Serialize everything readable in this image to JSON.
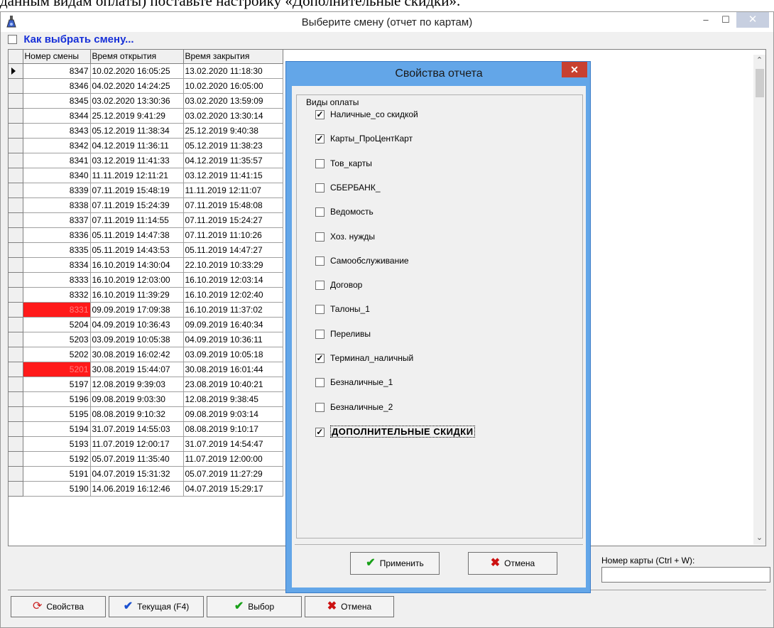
{
  "document": {
    "text_fragment": "данным видам оплаты) поставьте настройку «Дополнительные скидки»."
  },
  "window": {
    "title": "Выберите смену (отчет по картам)",
    "controls": {
      "minimize": "–",
      "maximize": "☐",
      "close": "✕"
    }
  },
  "help": {
    "checked": false,
    "link_text": "Как выбрать смену..."
  },
  "grid": {
    "columns": [
      "Номер смены",
      "Время открытия",
      "Время закрытия"
    ],
    "rows": [
      {
        "num": "8347",
        "open": "10.02.2020 16:05:25",
        "close": "13.02.2020 11:18:30",
        "current": true,
        "highlight": false
      },
      {
        "num": "8346",
        "open": "04.02.2020 14:24:25",
        "close": "10.02.2020 16:05:00",
        "current": false,
        "highlight": false
      },
      {
        "num": "8345",
        "open": "03.02.2020 13:30:36",
        "close": "03.02.2020 13:59:09",
        "current": false,
        "highlight": false
      },
      {
        "num": "8344",
        "open": "25.12.2019 9:41:29",
        "close": "03.02.2020 13:30:14",
        "current": false,
        "highlight": false
      },
      {
        "num": "8343",
        "open": "05.12.2019 11:38:34",
        "close": "25.12.2019 9:40:38",
        "current": false,
        "highlight": false
      },
      {
        "num": "8342",
        "open": "04.12.2019 11:36:11",
        "close": "05.12.2019 11:38:23",
        "current": false,
        "highlight": false
      },
      {
        "num": "8341",
        "open": "03.12.2019 11:41:33",
        "close": "04.12.2019 11:35:57",
        "current": false,
        "highlight": false
      },
      {
        "num": "8340",
        "open": "11.11.2019 12:11:21",
        "close": "03.12.2019 11:41:15",
        "current": false,
        "highlight": false
      },
      {
        "num": "8339",
        "open": "07.11.2019 15:48:19",
        "close": "11.11.2019 12:11:07",
        "current": false,
        "highlight": false
      },
      {
        "num": "8338",
        "open": "07.11.2019 15:24:39",
        "close": "07.11.2019 15:48:08",
        "current": false,
        "highlight": false
      },
      {
        "num": "8337",
        "open": "07.11.2019 11:14:55",
        "close": "07.11.2019 15:24:27",
        "current": false,
        "highlight": false
      },
      {
        "num": "8336",
        "open": "05.11.2019 14:47:38",
        "close": "07.11.2019 11:10:26",
        "current": false,
        "highlight": false
      },
      {
        "num": "8335",
        "open": "05.11.2019 14:43:53",
        "close": "05.11.2019 14:47:27",
        "current": false,
        "highlight": false
      },
      {
        "num": "8334",
        "open": "16.10.2019 14:30:04",
        "close": "22.10.2019 10:33:29",
        "current": false,
        "highlight": false
      },
      {
        "num": "8333",
        "open": "16.10.2019 12:03:00",
        "close": "16.10.2019 12:03:14",
        "current": false,
        "highlight": false
      },
      {
        "num": "8332",
        "open": "16.10.2019 11:39:29",
        "close": "16.10.2019 12:02:40",
        "current": false,
        "highlight": false
      },
      {
        "num": "8331",
        "open": "09.09.2019 17:09:38",
        "close": "16.10.2019 11:37:02",
        "current": false,
        "highlight": true
      },
      {
        "num": "5204",
        "open": "04.09.2019 10:36:43",
        "close": "09.09.2019 16:40:34",
        "current": false,
        "highlight": false
      },
      {
        "num": "5203",
        "open": "03.09.2019 10:05:38",
        "close": "04.09.2019 10:36:11",
        "current": false,
        "highlight": false
      },
      {
        "num": "5202",
        "open": "30.08.2019 16:02:42",
        "close": "03.09.2019 10:05:18",
        "current": false,
        "highlight": false
      },
      {
        "num": "5201",
        "open": "30.08.2019 15:44:07",
        "close": "30.08.2019 16:01:44",
        "current": false,
        "highlight": true
      },
      {
        "num": "5197",
        "open": "12.08.2019 9:39:03",
        "close": "23.08.2019 10:40:21",
        "current": false,
        "highlight": false
      },
      {
        "num": "5196",
        "open": "09.08.2019 9:03:30",
        "close": "12.08.2019 9:38:45",
        "current": false,
        "highlight": false
      },
      {
        "num": "5195",
        "open": "08.08.2019 9:10:32",
        "close": "09.08.2019 9:03:14",
        "current": false,
        "highlight": false
      },
      {
        "num": "5194",
        "open": "31.07.2019 14:55:03",
        "close": "08.08.2019 9:10:17",
        "current": false,
        "highlight": false
      },
      {
        "num": "5193",
        "open": "11.07.2019 12:00:17",
        "close": "31.07.2019 14:54:47",
        "current": false,
        "highlight": false
      },
      {
        "num": "5192",
        "open": "05.07.2019 11:35:40",
        "close": "11.07.2019 12:00:00",
        "current": false,
        "highlight": false
      },
      {
        "num": "5191",
        "open": "04.07.2019 15:31:32",
        "close": "05.07.2019 11:27:29",
        "current": false,
        "highlight": false
      },
      {
        "num": "5190",
        "open": "14.06.2019 16:12:46",
        "close": "04.07.2019 15:29:17",
        "current": false,
        "highlight": false
      }
    ]
  },
  "card_search": {
    "label": "Номер карты (Ctrl + W):",
    "value": ""
  },
  "bottom_buttons": {
    "properties": "Свойства",
    "current": "Текущая (F4)",
    "select": "Выбор",
    "cancel": "Отмена"
  },
  "dialog": {
    "title": "Свойства отчета",
    "close": "✕",
    "group_label": "Виды оплаты",
    "options": [
      {
        "label": "Наличные_со скидкой",
        "checked": true,
        "bold": false
      },
      {
        "label": "Карты_ПроЦентКарт",
        "checked": true,
        "bold": false
      },
      {
        "label": "Тов_карты",
        "checked": false,
        "bold": false
      },
      {
        "label": "СБЕРБАНК_",
        "checked": false,
        "bold": false
      },
      {
        "label": "Ведомость",
        "checked": false,
        "bold": false
      },
      {
        "label": "Хоз. нужды",
        "checked": false,
        "bold": false
      },
      {
        "label": "Самообслуживание",
        "checked": false,
        "bold": false
      },
      {
        "label": "Договор",
        "checked": false,
        "bold": false
      },
      {
        "label": "Талоны_1",
        "checked": false,
        "bold": false
      },
      {
        "label": "Переливы",
        "checked": false,
        "bold": false
      },
      {
        "label": "Терминал_наличный",
        "checked": true,
        "bold": false
      },
      {
        "label": "Безналичные_1",
        "checked": false,
        "bold": false
      },
      {
        "label": "Безналичные_2",
        "checked": false,
        "bold": false
      },
      {
        "label": "ДОПОЛНИТЕЛЬНЫЕ СКИДКИ",
        "checked": true,
        "bold": true
      }
    ],
    "apply": "Применить",
    "cancel": "Отмена"
  },
  "colors": {
    "highlight_row": "#ff1a1a",
    "dialog_frame": "#63a6e8",
    "link": "#1730d8"
  },
  "icons": {
    "app": "flask-icon",
    "check": "checkmark-icon",
    "cancel": "red-x-icon",
    "properties": "refresh-icon"
  }
}
